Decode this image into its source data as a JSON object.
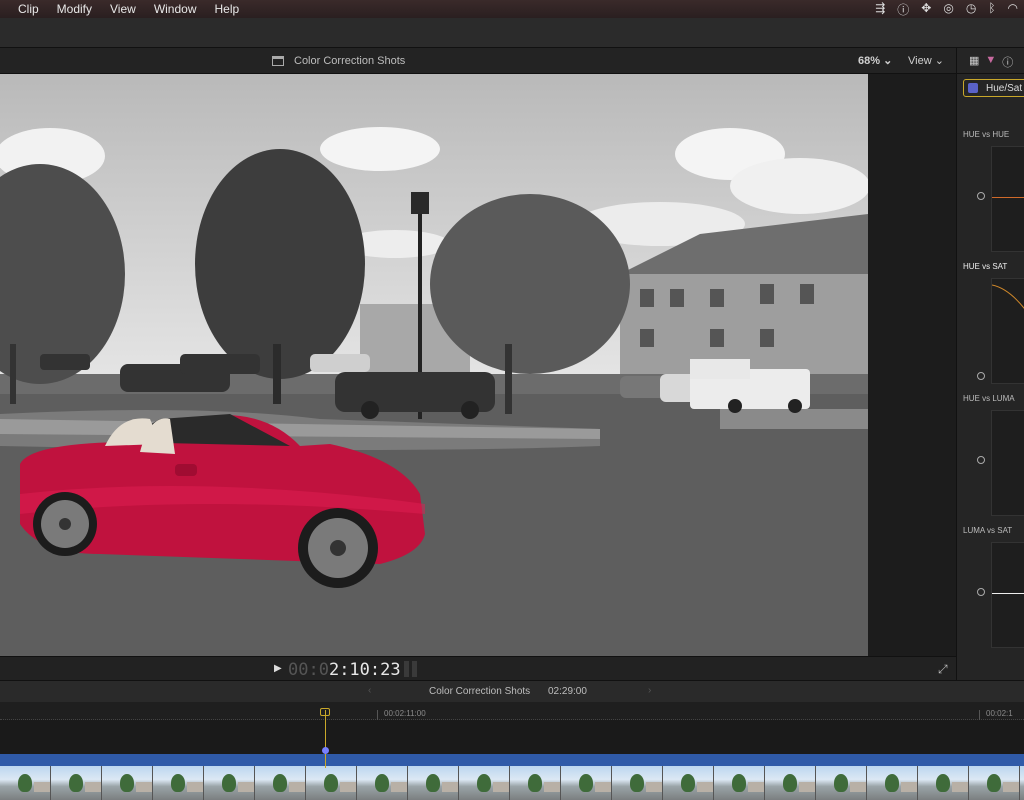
{
  "menu": {
    "items": [
      "Clip",
      "Modify",
      "View",
      "Window",
      "Help"
    ]
  },
  "viewer": {
    "title": "Color Correction Shots",
    "zoom": "68%",
    "view_label": "View"
  },
  "inspector": {
    "effect_label": "Hue/Sat",
    "curves": [
      "HUE vs HUE",
      "HUE vs SAT",
      "HUE vs LUMA",
      "LUMA vs SAT"
    ]
  },
  "transport": {
    "timecode_dim": "00:0",
    "timecode_bright": "2:10:23"
  },
  "timeline": {
    "project_name": "Color Correction Shots",
    "duration": "02:29:00",
    "ruler_marks": [
      "00:02:11:00",
      "00:02:1"
    ]
  },
  "colors": {
    "accent": "#c9a82a",
    "clip_blue": "#2f5aa8",
    "car_red": "#c0123e"
  }
}
